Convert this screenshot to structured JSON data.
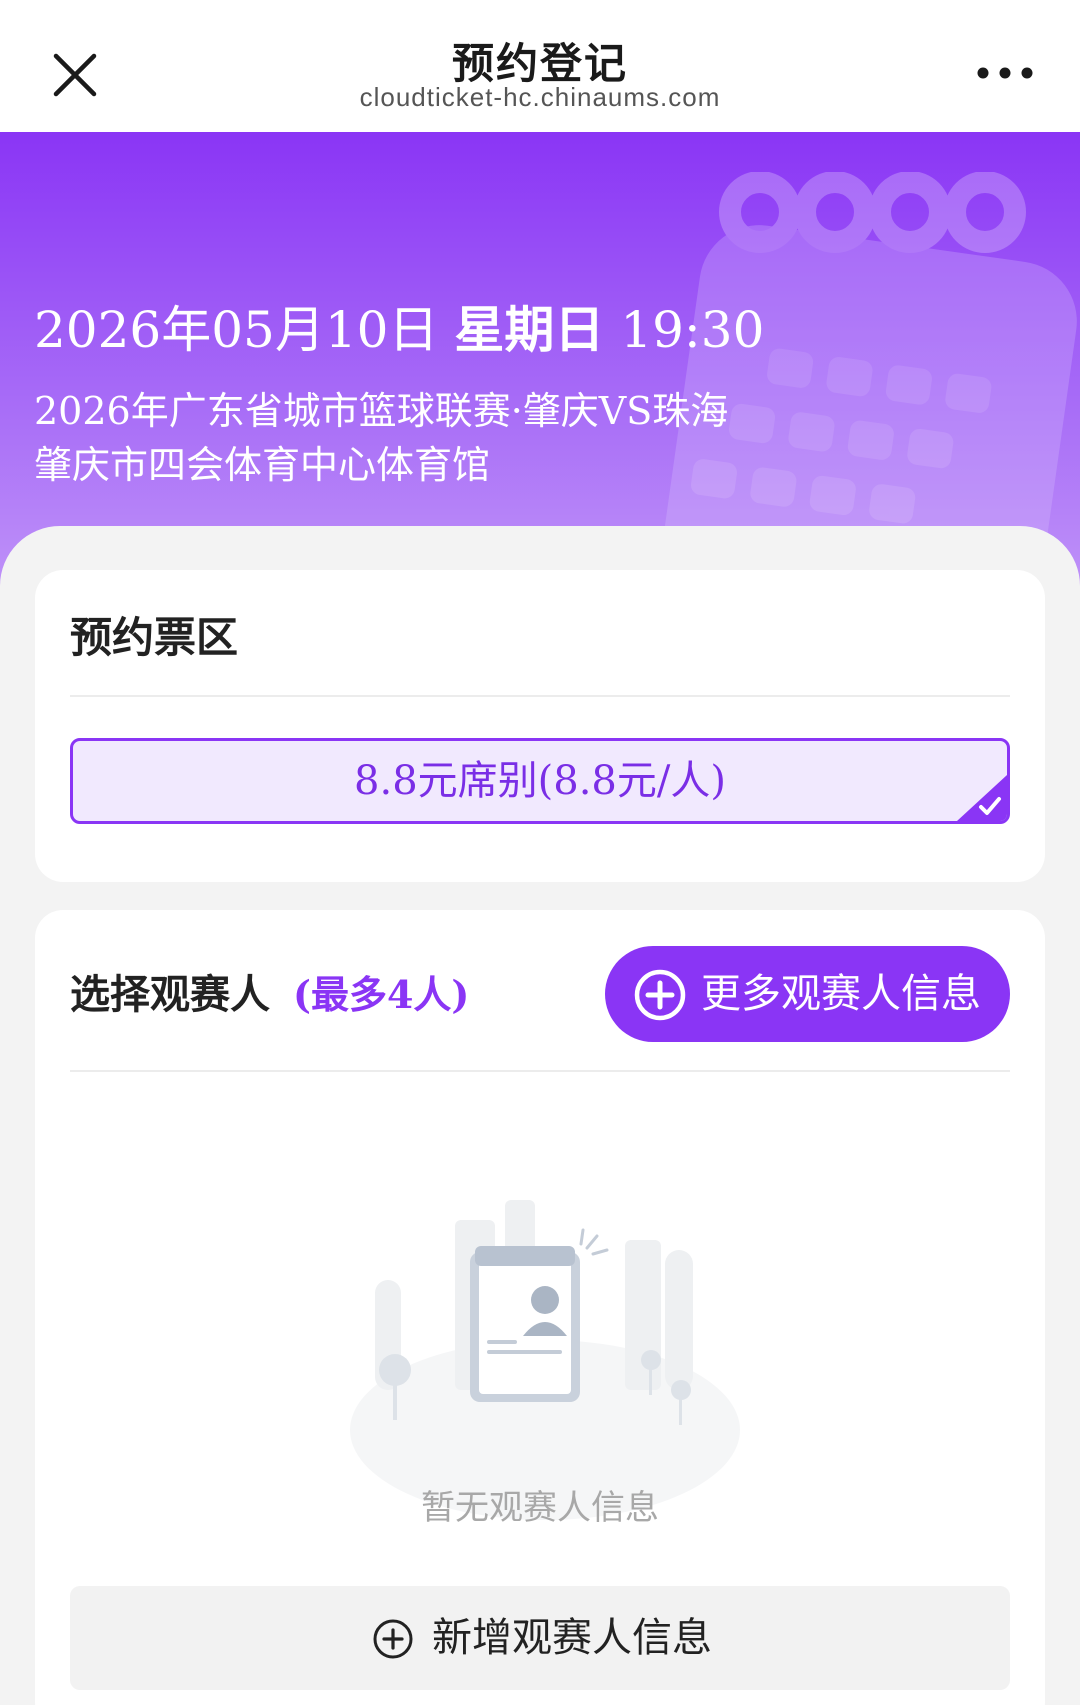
{
  "nav": {
    "title": "预约登记",
    "url": "cloudticket-hc.chinaums.com"
  },
  "event": {
    "date": "2026年05月10日",
    "weekday": "星期日",
    "time": "19:30",
    "name": "2026年广东省城市篮球联赛·肇庆VS珠海",
    "venue": "肇庆市四会体育中心体育馆"
  },
  "ticket_zone": {
    "title": "预约票区",
    "options": [
      {
        "label": "8.8元席别(8.8元/人)",
        "selected": true
      }
    ]
  },
  "audience": {
    "title": "选择观赛人",
    "limit": "(最多4人)",
    "more_button": "更多观赛人信息",
    "empty_text": "暂无观赛人信息",
    "add_button": "新增观赛人信息"
  },
  "colors": {
    "accent": "#8a35f5",
    "accent_light": "#f1e9fe",
    "background": "#f3f3f3"
  }
}
